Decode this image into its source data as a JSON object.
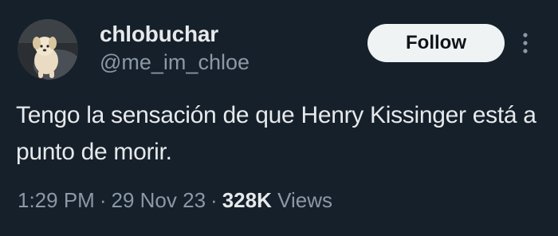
{
  "user": {
    "display_name": "chlobuchar",
    "handle": "@me_im_chloe"
  },
  "actions": {
    "follow_label": "Follow",
    "more_icon": "more-vertical-icon"
  },
  "tweet": {
    "text": "Tengo la sensación de que Henry Kissinger está a punto de morir."
  },
  "meta": {
    "time": "1:29 PM",
    "separator": "·",
    "date": "29 Nov 23",
    "views_count": "328K",
    "views_label": "Views"
  },
  "colors": {
    "background": "#15202b",
    "primary_text": "#e7e9ea",
    "secondary_text": "#8b98a5",
    "follow_bg": "#eff3f4"
  }
}
